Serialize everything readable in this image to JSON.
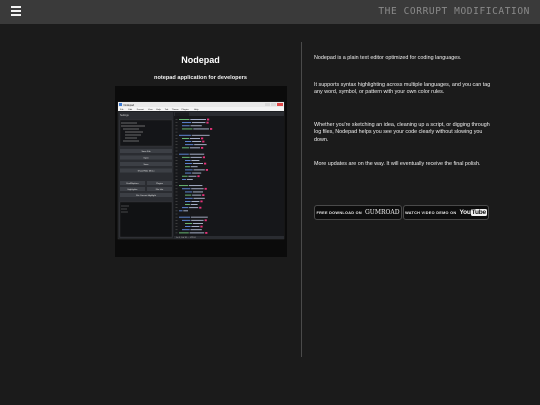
{
  "topbar": {
    "brand": "THE CORRUPT MODIFICATION"
  },
  "product": {
    "title": "Nodepad",
    "subtitle": "notepad application for developers"
  },
  "screenshot": {
    "window_title": "Nodepad",
    "menu_items": [
      "File",
      "Edit",
      "Format",
      "View",
      "Help",
      "Tab",
      "Theme",
      "Plugins",
      "Help"
    ],
    "sidebar_header": "Settings",
    "sidebar_buttons": [
      "Save File",
      "Open",
      "Save",
      "Show/Hide Menu"
    ],
    "sidebar_pairs": [
      [
        "Find/Replace",
        "Plugins"
      ],
      [
        "Highlighter",
        "File Info"
      ]
    ],
    "sidebar_wide_button": "File Convert Highlight",
    "status_text": "Ln 4, Col 18 — UTF-8"
  },
  "description": {
    "p1": "Nodepad is a plain text editor optimized for coding languages.",
    "p2": "It supports syntax highlighting across multiple languages, and you can tag any word, symbol, or pattern with your own color rules.",
    "p3": "Whether you're sketching an idea, cleaning up a script, or digging through log files, Nodepad helps you see your code clearly without slowing you down.",
    "p4": "More updates are on the way. It will eventually receive the final polish."
  },
  "buttons": {
    "download_prefix": "FREE DOWNLOAD ON",
    "download_brand": "GUMROAD",
    "demo_prefix": "WATCH VIDEO DEMO ON",
    "demo_brand_a": "You",
    "demo_brand_b": "Tube"
  },
  "colors": {
    "background": "#1b1b1b",
    "topbar": "#3a3a3a",
    "accent_pink": "#e8337a",
    "code_blue": "#6f9fff",
    "code_green": "#7ddf8a"
  }
}
